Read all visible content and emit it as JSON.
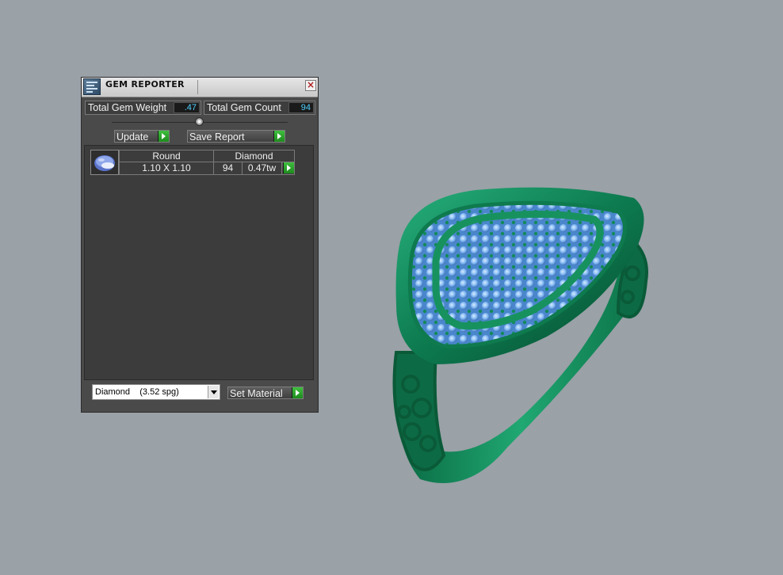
{
  "window": {
    "title": "GEM REPORTER",
    "close_label": "×"
  },
  "stats": {
    "total_weight_label": "Total Gem Weight",
    "total_weight_value": ".47",
    "total_count_label": "Total Gem Count",
    "total_count_value": "94"
  },
  "actions": {
    "update_label": "Update",
    "save_report_label": "Save Report"
  },
  "gem_list": {
    "rows": [
      {
        "shape": "Round",
        "material": "Diamond",
        "size": "1.10 X 1.10",
        "count": "94",
        "weight": "0.47tw"
      }
    ]
  },
  "material": {
    "selected": "Diamond    (3.52 spg)",
    "set_material_label": "Set Material"
  },
  "colors": {
    "accent_value": "#4fd1ff",
    "go_button": "#2fa82f",
    "ring_metal": "#0f7a4f",
    "gem": "#7fb6f2",
    "viewport_bg": "#9aa1a7"
  },
  "icons": {
    "app": "gem-reporter-app-icon",
    "close": "close-icon",
    "go": "play-arrow-icon",
    "dropdown": "chevron-down-icon"
  }
}
